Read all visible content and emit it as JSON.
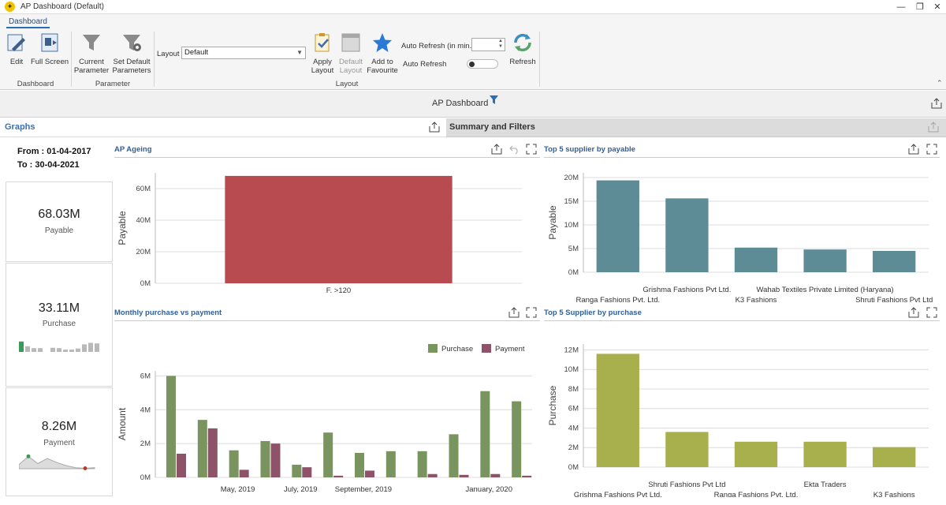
{
  "window": {
    "title": "AP Dashboard (Default)"
  },
  "ribbon": {
    "tab": "Dashboard",
    "buttons": {
      "edit": "Edit",
      "full_screen": "Full Screen",
      "current_parameter": [
        "Current",
        "Parameter"
      ],
      "set_default_parameters": [
        "Set Default",
        "Parameters"
      ],
      "apply_layout": [
        "Apply",
        "Layout"
      ],
      "default_layout": [
        "Default",
        "Layout"
      ],
      "add_to_favourite": [
        "Add to",
        "Favourite"
      ],
      "refresh": "Refresh"
    },
    "groups": {
      "dashboard": "Dashboard",
      "parameter": "Parameter",
      "layout": "Layout"
    },
    "layout_label": "Layout",
    "layout_value": "Default",
    "auto_refresh_min_label": "Auto Refresh (in min.)",
    "auto_refresh_label": "Auto Refresh"
  },
  "dashboard": {
    "title": "AP Dashboard"
  },
  "tabs": {
    "graphs": "Graphs",
    "summary": "Summary and Filters"
  },
  "dates": {
    "from": "From : 01-04-2017",
    "to": "To : 30-04-2021"
  },
  "kpis": [
    {
      "value": "68.03M",
      "label": "Payable"
    },
    {
      "value": "33.11M",
      "label": "Purchase",
      "spark": [
        0.55,
        0.3,
        0.2,
        0.2,
        0,
        0.22,
        0.2,
        0.12,
        0.12,
        0.18,
        0.4,
        0.48,
        0.45
      ]
    },
    {
      "value": "8.26M",
      "label": "Payment",
      "spark": [
        0.2,
        0.6,
        0.25,
        0.5,
        0.3,
        0.15,
        0.05,
        0.02,
        0.05
      ]
    }
  ],
  "panels": {
    "ap_ageing": "AP Ageing",
    "top_payable": "Top 5 supplier by payable",
    "monthly": "Monthly purchase vs payment",
    "top_purchase": "Top 5 Supplier by purchase"
  },
  "colors": {
    "ageing": "#b84b50",
    "payable": "#5e8c96",
    "purchase_green": "#7a9460",
    "payment": "#8f5369",
    "supplier_purchase": "#a8b04d",
    "accent": "#3a6fb0"
  },
  "chart_data": [
    {
      "id": "ap_ageing",
      "type": "bar",
      "ylabel": "Payable",
      "categories": [
        "F. >120"
      ],
      "values": [
        68.03
      ],
      "ylim": [
        0,
        70
      ],
      "yticks": [
        0,
        20,
        40,
        60
      ],
      "ytick_labels": [
        "0M",
        "20M",
        "40M",
        "60M"
      ],
      "grid": true
    },
    {
      "id": "top_payable",
      "type": "bar",
      "ylabel": "Payable",
      "categories": [
        "Ranga Fashions Pvt. Ltd.",
        "Grishma Fashions Pvt Ltd.",
        "K3 Fashions",
        "Wahab Textiles Private Limited (Haryana)",
        "Shruti Fashions Pvt Ltd"
      ],
      "values": [
        19.4,
        15.6,
        5.2,
        4.8,
        4.5
      ],
      "ylim": [
        0,
        21
      ],
      "yticks": [
        0,
        5,
        10,
        15,
        20
      ],
      "ytick_labels": [
        "0M",
        "5M",
        "10M",
        "15M",
        "20M"
      ],
      "grid": true
    },
    {
      "id": "monthly",
      "type": "bar",
      "ylabel": "Amount",
      "legend": "top-right",
      "x_labels": [
        {
          "label": "May, 2019",
          "index": 2
        },
        {
          "label": "July, 2019",
          "index": 4
        },
        {
          "label": "September, 2019",
          "index": 6
        },
        {
          "label": "January, 2020",
          "index": 10
        }
      ],
      "series": [
        {
          "name": "Purchase",
          "values": [
            6.0,
            3.4,
            1.6,
            2.15,
            0.75,
            2.65,
            1.45,
            1.55,
            1.55,
            2.55,
            5.1,
            4.5
          ]
        },
        {
          "name": "Payment",
          "values": [
            1.4,
            2.9,
            0.45,
            2.0,
            0.6,
            0.1,
            0.4,
            0.0,
            0.2,
            0.15,
            0.2,
            0.1
          ]
        }
      ],
      "ylim": [
        0,
        6.3
      ],
      "yticks": [
        0,
        2,
        4,
        6
      ],
      "ytick_labels": [
        "0M",
        "2M",
        "4M",
        "6M"
      ],
      "grid": true
    },
    {
      "id": "top_purchase",
      "type": "bar",
      "ylabel": "Purchase",
      "categories": [
        "Grishma Fashions Pvt Ltd.",
        "Shruti Fashions Pvt Ltd",
        "Ranga Fashions Pvt. Ltd.",
        "Ekta Traders",
        "K3 Fashions"
      ],
      "values": [
        11.6,
        3.6,
        2.6,
        2.6,
        2.05
      ],
      "ylim": [
        0,
        12.6
      ],
      "yticks": [
        0,
        2,
        4,
        6,
        8,
        10,
        12
      ],
      "ytick_labels": [
        "0M",
        "2M",
        "4M",
        "6M",
        "8M",
        "10M",
        "12M"
      ],
      "grid": true
    }
  ]
}
